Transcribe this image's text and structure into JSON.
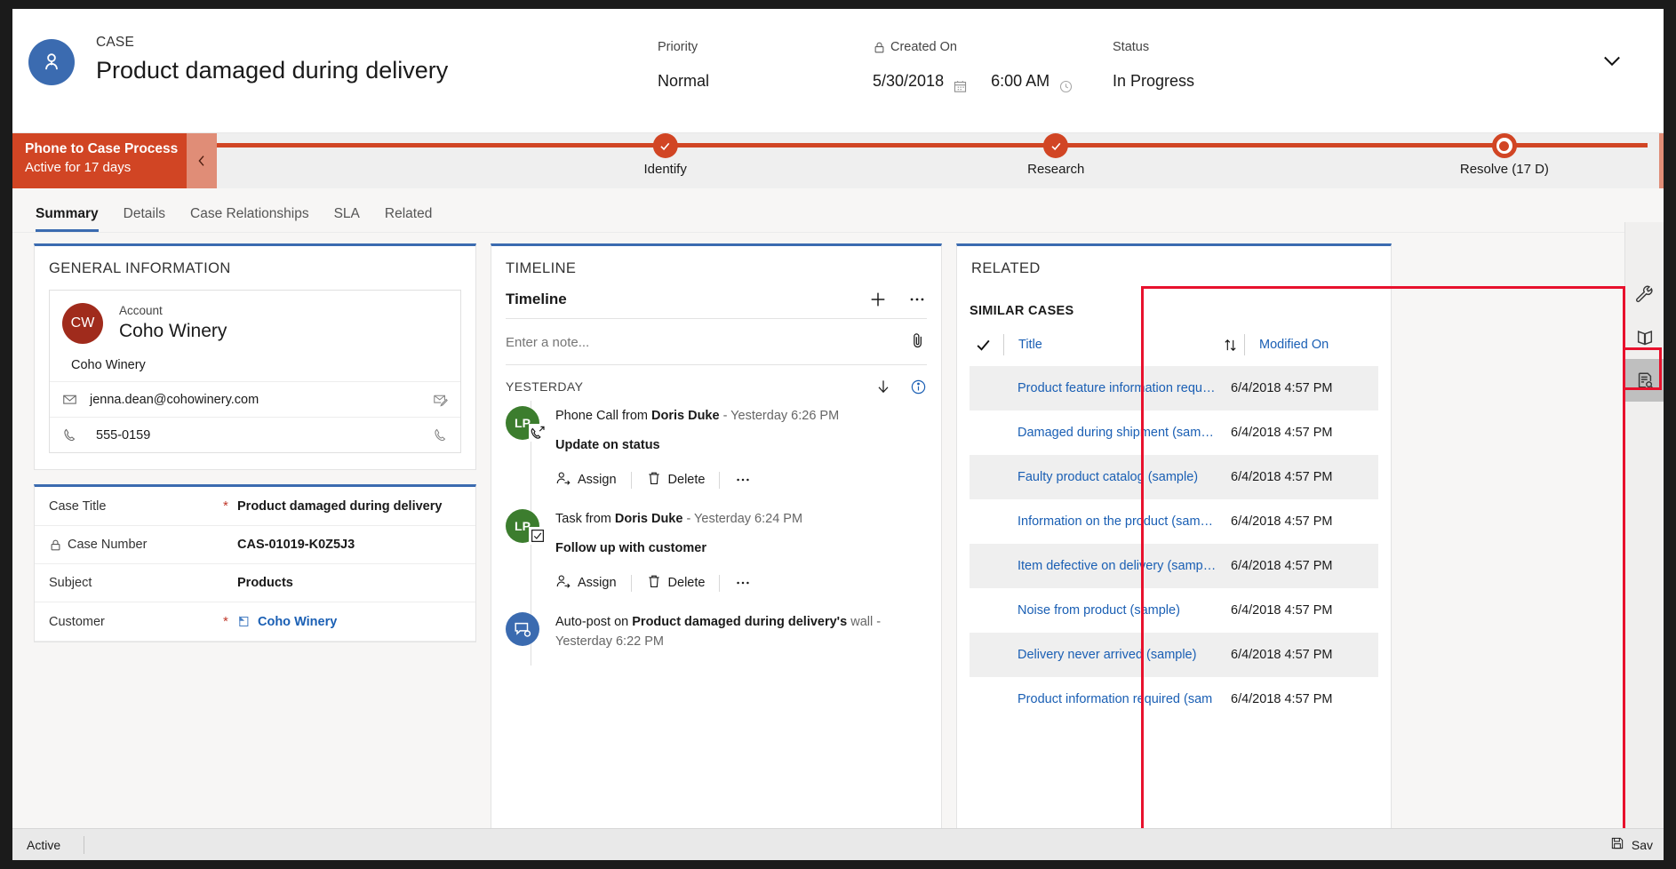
{
  "header": {
    "entity_type": "CASE",
    "entity_name": "Product damaged during delivery",
    "avatar_icon": "person-icon",
    "collapse_icon": "chevron-down-icon",
    "fields": {
      "priority_label": "Priority",
      "priority_value": "Normal",
      "created_on_label": "Created On",
      "created_on_lock_icon": "lock-icon",
      "created_on_date": "5/30/2018",
      "created_on_calendar_icon": "calendar-icon",
      "created_on_time": "6:00 AM",
      "created_on_clock_icon": "clock-icon",
      "status_label": "Status",
      "status_value": "In Progress"
    }
  },
  "process_flow": {
    "name": "Phone to Case Process",
    "subtitle": "Active for 17 days",
    "collapse_icon": "chevron-left-icon",
    "accent_color": "#d14524",
    "stages": [
      {
        "label": "Identify",
        "state": "complete",
        "icon": "check-icon"
      },
      {
        "label": "Research",
        "state": "complete",
        "icon": "check-icon"
      },
      {
        "label": "Resolve  (17 D)",
        "state": "active",
        "icon": "current-stage-icon"
      }
    ]
  },
  "tabs": [
    {
      "label": "Summary",
      "active": true
    },
    {
      "label": "Details",
      "active": false
    },
    {
      "label": "Case Relationships",
      "active": false
    },
    {
      "label": "SLA",
      "active": false
    },
    {
      "label": "Related",
      "active": false
    }
  ],
  "general_information": {
    "title": "GENERAL INFORMATION",
    "account_card": {
      "initials": "CW",
      "label": "Account",
      "name": "Coho Winery",
      "secondary_name": "Coho Winery",
      "rows": [
        {
          "lead_icon": "mail-icon",
          "value": "jenna.dean@cohowinery.com",
          "trail_icon": "compose-email-icon"
        },
        {
          "lead_icon": "phone-icon",
          "value": "555-0159",
          "trail_icon": "call-icon"
        }
      ]
    },
    "fields": [
      {
        "label": "Case Title",
        "required": true,
        "value": "Product damaged during delivery",
        "type": "text",
        "lock": false
      },
      {
        "label": "Case Number",
        "required": false,
        "value": "CAS-01019-K0Z5J3",
        "type": "text",
        "lock": true
      },
      {
        "label": "Subject",
        "required": false,
        "value": "Products",
        "type": "text",
        "lock": false
      },
      {
        "label": "Customer",
        "required": true,
        "value": "Coho Winery",
        "type": "link",
        "lock": false,
        "icon": "account-record-icon"
      }
    ]
  },
  "timeline": {
    "title": "TIMELINE",
    "subtitle": "Timeline",
    "add_icon": "plus-icon",
    "more_icon": "ellipsis-icon",
    "note_placeholder": "Enter a note...",
    "attach_icon": "paperclip-icon",
    "group_label": "YESTERDAY",
    "sort_icon": "arrow-down-icon",
    "info_icon": "info-icon",
    "actions": {
      "assign": "Assign",
      "delete": "Delete",
      "more": "…",
      "assign_icon": "assign-user-icon",
      "delete_icon": "trash-icon",
      "more_icon": "ellipsis-icon"
    },
    "items": [
      {
        "avatar_initials": "LP",
        "avatar_color": "#3c7d2e",
        "badge_icon": "phone-outgoing-icon",
        "prefix": "Phone Call from ",
        "actor": "Doris Duke",
        "meta": " -  Yesterday 6:26 PM",
        "subject": "Update on status",
        "has_actions": true
      },
      {
        "avatar_initials": "LP",
        "avatar_color": "#3c7d2e",
        "badge_icon": "task-check-icon",
        "prefix": "Task from ",
        "actor": "Doris Duke",
        "meta": "  -  Yesterday 6:24 PM",
        "subject": "Follow up with customer",
        "has_actions": true
      },
      {
        "avatar_initials": "",
        "avatar_color": "#3b6bb0",
        "badge_icon": "auto-post-icon",
        "prefix": "Auto-post on ",
        "actor": "Product damaged during delivery's",
        "meta": " wall -  Yesterday 6:22 PM",
        "subject": "",
        "has_actions": false
      }
    ]
  },
  "related": {
    "title": "RELATED",
    "similar_cases": {
      "title": "SIMILAR CASES",
      "columns": {
        "check_icon": "check-icon",
        "title": "Title",
        "sort_icon": "sort-icon",
        "modified_on": "Modified On"
      },
      "rows": [
        {
          "title": "Product feature information requir...",
          "modified_on": "6/4/2018 4:57 PM"
        },
        {
          "title": "Damaged during shipment (sample)",
          "modified_on": "6/4/2018 4:57 PM"
        },
        {
          "title": "Faulty product catalog (sample)",
          "modified_on": "6/4/2018 4:57 PM"
        },
        {
          "title": "Information on the product (sample)",
          "modified_on": "6/4/2018 4:57 PM"
        },
        {
          "title": "Item defective on delivery (sample)",
          "modified_on": "6/4/2018 4:57 PM"
        },
        {
          "title": "Noise from product (sample)",
          "modified_on": "6/4/2018 4:57 PM"
        },
        {
          "title": "Delivery never arrived (sample)",
          "modified_on": "6/4/2018 4:57 PM"
        },
        {
          "title": "Product information required (sam",
          "modified_on": "6/4/2018 4:57 PM"
        }
      ]
    }
  },
  "rail": [
    {
      "icon": "wrench-icon",
      "selected": false
    },
    {
      "icon": "knowledge-book-icon",
      "selected": false
    },
    {
      "icon": "similar-cases-icon",
      "selected": true
    }
  ],
  "status_bar": {
    "state": "Active",
    "save_label": "Sav",
    "save_icon": "save-icon"
  },
  "highlight_color": "#e8112d"
}
